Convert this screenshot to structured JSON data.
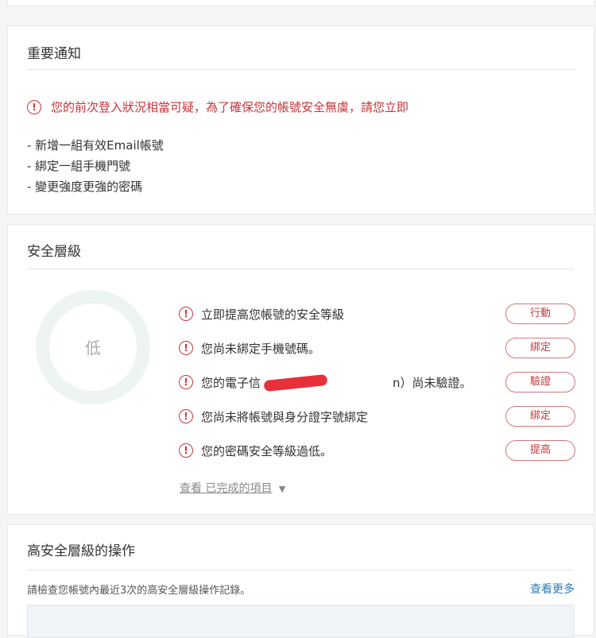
{
  "notice": {
    "title": "重要通知",
    "alert": "您的前次登入狀況相當可疑，為了確保您的帳號安全無虞，請您立即",
    "items": [
      "- 新增一組有效Email帳號",
      "- 綁定一組手機門號",
      "- 變更強度更強的密碼"
    ]
  },
  "security": {
    "title": "安全層級",
    "level_label": "低",
    "rows": [
      {
        "text": "立即提高您帳號的安全等級",
        "button": "行動"
      },
      {
        "text": "您尚未綁定手機號碼。",
        "button": "綁定"
      },
      {
        "text_prefix": "您的電子信",
        "text_suffix": "n）尚未驗證。",
        "button": "驗證"
      },
      {
        "text": "您尚未將帳號與身分證字號綁定",
        "button": "綁定"
      },
      {
        "text": "您的密碼安全等級過低。",
        "button": "提高"
      }
    ],
    "view_completed": "查看 已完成的項目",
    "view_completed_arrow": "▼"
  },
  "high_ops": {
    "title": "高安全層級的操作",
    "description": "請檢查您帳號內最近3次的高安全層級操作記錄。",
    "more_link": "查看更多"
  },
  "colors": {
    "accent_red": "#c9353b",
    "link_blue": "#2b7bb9"
  },
  "icons": {
    "warning": "!"
  }
}
